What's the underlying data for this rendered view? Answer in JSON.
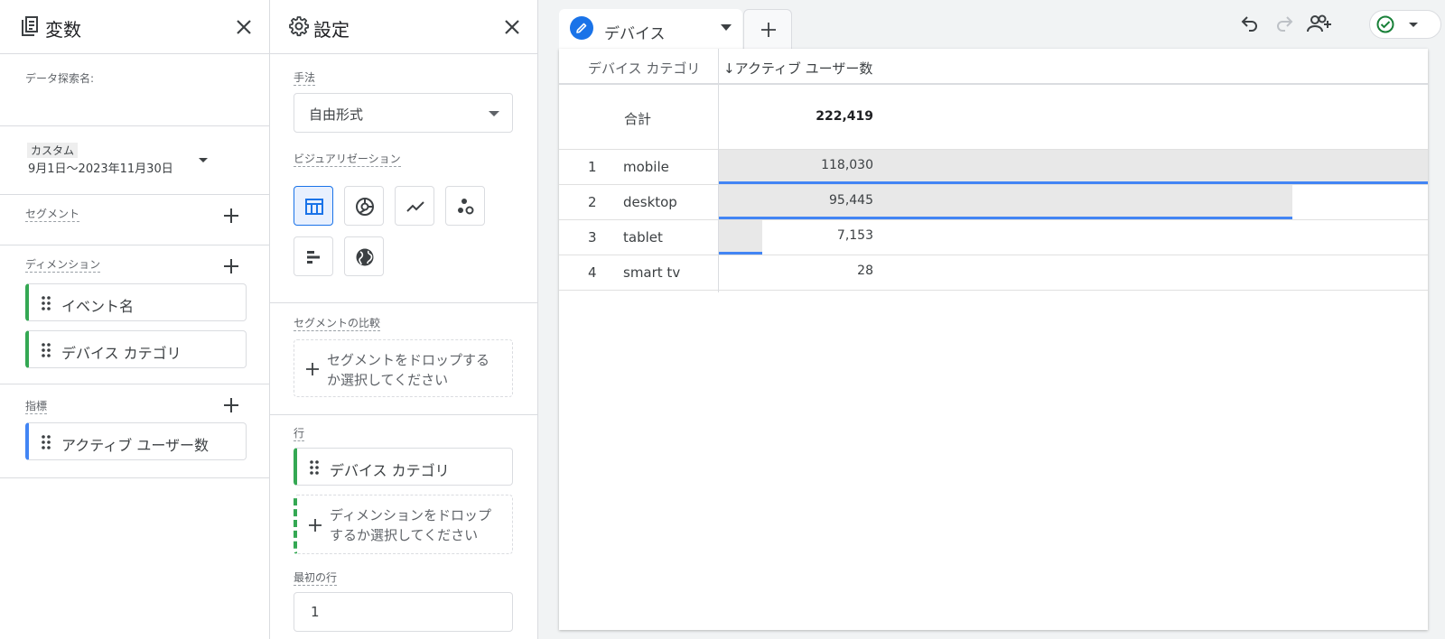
{
  "variables": {
    "title": "変数",
    "exploration_label": "データ探索名:",
    "date_badge": "カスタム",
    "date_range": "9月1日～2023年11月30日",
    "segments_label": "セグメント",
    "dimensions_label": "ディメンション",
    "dimensions": [
      "イベント名",
      "デバイス カテゴリ"
    ],
    "metrics_label": "指標",
    "metrics": [
      "アクティブ ユーザー数"
    ]
  },
  "settings": {
    "title": "設定",
    "technique_label": "手法",
    "technique_value": "自由形式",
    "visualization_label": "ビジュアリゼーション",
    "visualizations": [
      "table-icon",
      "donut-chart-icon",
      "line-chart-icon",
      "scatter-icon",
      "bar-chart-icon",
      "globe-icon"
    ],
    "segment_compare_label": "セグメントの比較",
    "segment_drop_text_1": "セグメントをドロップする",
    "segment_drop_text_2": "か選択してください",
    "rows_label": "行",
    "row_dimension": "デバイス カテゴリ",
    "dimension_drop_text_1": "ディメンションをドロップ",
    "dimension_drop_text_2": "するか選択してください",
    "first_row_label": "最初の行",
    "first_row_value": "1"
  },
  "tab": {
    "label": "デバイス"
  },
  "table": {
    "col_dimension": "デバイス カテゴリ",
    "col_metric": "↓アクティブ ユーザー数",
    "total_label": "合計",
    "total_value": "222,419",
    "max_value": 118030,
    "rows": [
      {
        "index": "1",
        "name": "mobile",
        "value": "118,030",
        "raw": 118030
      },
      {
        "index": "2",
        "name": "desktop",
        "value": "95,445",
        "raw": 95445
      },
      {
        "index": "3",
        "name": "tablet",
        "value": "7,153",
        "raw": 7153
      },
      {
        "index": "4",
        "name": "smart tv",
        "value": "28",
        "raw": 28
      }
    ]
  },
  "colors": {
    "accent": "#1a73e8",
    "dimension": "#34a853",
    "metric": "#4285f4",
    "status_ok": "#188038"
  }
}
